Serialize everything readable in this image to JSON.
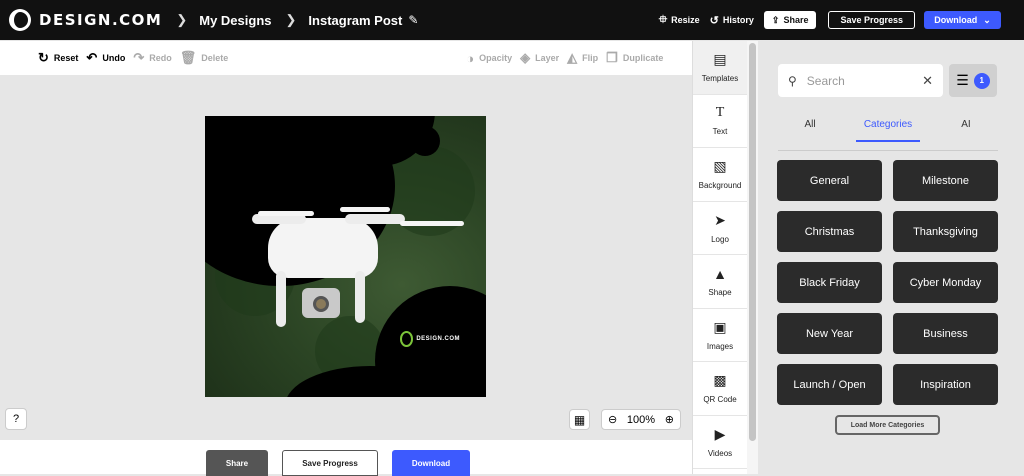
{
  "header": {
    "brand": "DESIGN.COM",
    "breadcrumbs": [
      "My Designs",
      "Instagram Post"
    ],
    "resize_label": "Resize",
    "history_label": "History",
    "share_label": "Share",
    "save_label": "Save Progress",
    "download_label": "Download"
  },
  "toolbar": {
    "reset": "Reset",
    "undo": "Undo",
    "redo": "Redo",
    "delete": "Delete",
    "opacity": "Opacity",
    "layer": "Layer",
    "flip": "Flip",
    "duplicate": "Duplicate"
  },
  "canvas": {
    "watermark": "DESIGN.COM",
    "zoom": "100%"
  },
  "bottom": {
    "share": "Share",
    "save": "Save Progress",
    "download": "Download"
  },
  "sidenav": {
    "items": [
      "Templates",
      "Text",
      "Background",
      "Logo",
      "Shape",
      "Images",
      "QR Code",
      "Videos"
    ]
  },
  "panel": {
    "search_placeholder": "Search",
    "filter_count": "1",
    "tabs": [
      "All",
      "Categories",
      "AI"
    ],
    "categories": [
      "General",
      "Milestone",
      "Christmas",
      "Thanksgiving",
      "Black Friday",
      "Cyber Monday",
      "New Year",
      "Business",
      "Launch / Open",
      "Inspiration"
    ],
    "load_more": "Load More Categories"
  },
  "colors": {
    "accent": "#3d5afe",
    "topbar": "#111111",
    "category_bg": "#2b2b2b"
  }
}
